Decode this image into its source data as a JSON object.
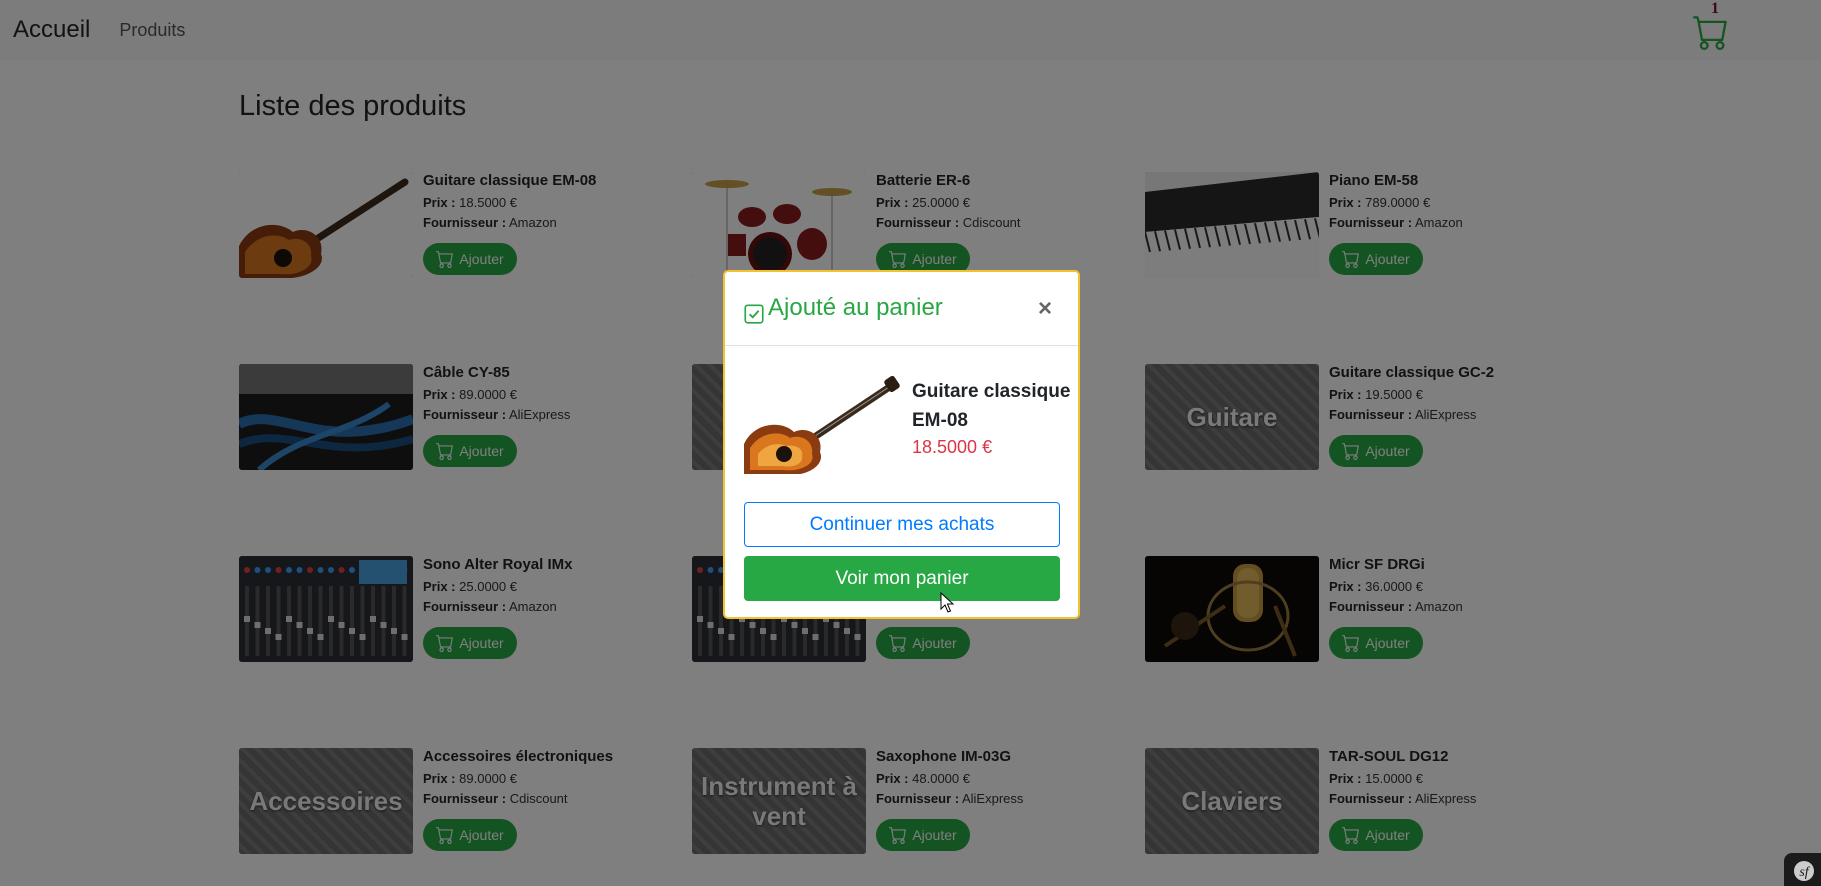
{
  "navbar": {
    "brand": "Accueil",
    "products_link": "Produits",
    "cart_count": "1"
  },
  "page_title": "Liste des produits",
  "labels": {
    "price": "Prix :",
    "supplier": "Fournisseur :",
    "add_button": "Ajouter"
  },
  "products": [
    {
      "name": "Guitare classique EM-08",
      "price": "18.5000 €",
      "supplier": "Amazon",
      "thumb_text": "",
      "image": "guitar"
    },
    {
      "name": "Batterie ER-6",
      "price": "25.0000 €",
      "supplier": "Cdiscount",
      "thumb_text": "",
      "image": "drums"
    },
    {
      "name": "Piano EM-58",
      "price": "789.0000 €",
      "supplier": "Amazon",
      "thumb_text": "",
      "image": "piano"
    },
    {
      "name": "Câble CY-85",
      "price": "89.0000 €",
      "supplier": "AliExpress",
      "thumb_text": "",
      "image": "cable"
    },
    {
      "name": "",
      "price": "",
      "supplier": "",
      "thumb_text": "",
      "image": "hidden"
    },
    {
      "name": "Guitare classique GC-2",
      "price": "19.5000 €",
      "supplier": "AliExpress",
      "thumb_text": "Guitare",
      "image": "placeholder"
    },
    {
      "name": "Sono Alter Royal IMx",
      "price": "25.0000 €",
      "supplier": "Amazon",
      "thumb_text": "",
      "image": "mixer"
    },
    {
      "name": "",
      "price": "",
      "supplier": "",
      "thumb_text": "",
      "image": "mixer"
    },
    {
      "name": "Micr SF DRGi",
      "price": "36.0000 €",
      "supplier": "Amazon",
      "thumb_text": "",
      "image": "mic"
    },
    {
      "name": "Accessoires électroniques",
      "price": "89.0000 €",
      "supplier": "Cdiscount",
      "thumb_text": "Accessoires",
      "image": "placeholder"
    },
    {
      "name": "Saxophone IM-03G",
      "price": "48.0000 €",
      "supplier": "AliExpress",
      "thumb_text": "Instrument à vent",
      "image": "placeholder"
    },
    {
      "name": "TAR-SOUL DG12",
      "price": "15.0000 €",
      "supplier": "AliExpress",
      "thumb_text": "Claviers",
      "image": "placeholder"
    }
  ],
  "modal": {
    "title": "Ajouté au panier",
    "close": "×",
    "product_name": "Guitare classique EM-08",
    "product_price": "18.5000 €",
    "continue_label": "Continuer mes achats",
    "view_cart_label": "Voir mon panier"
  },
  "colors": {
    "success": "#28a745",
    "primary": "#007bff",
    "price_red": "#dc3545",
    "modal_border": "#f2c231"
  }
}
